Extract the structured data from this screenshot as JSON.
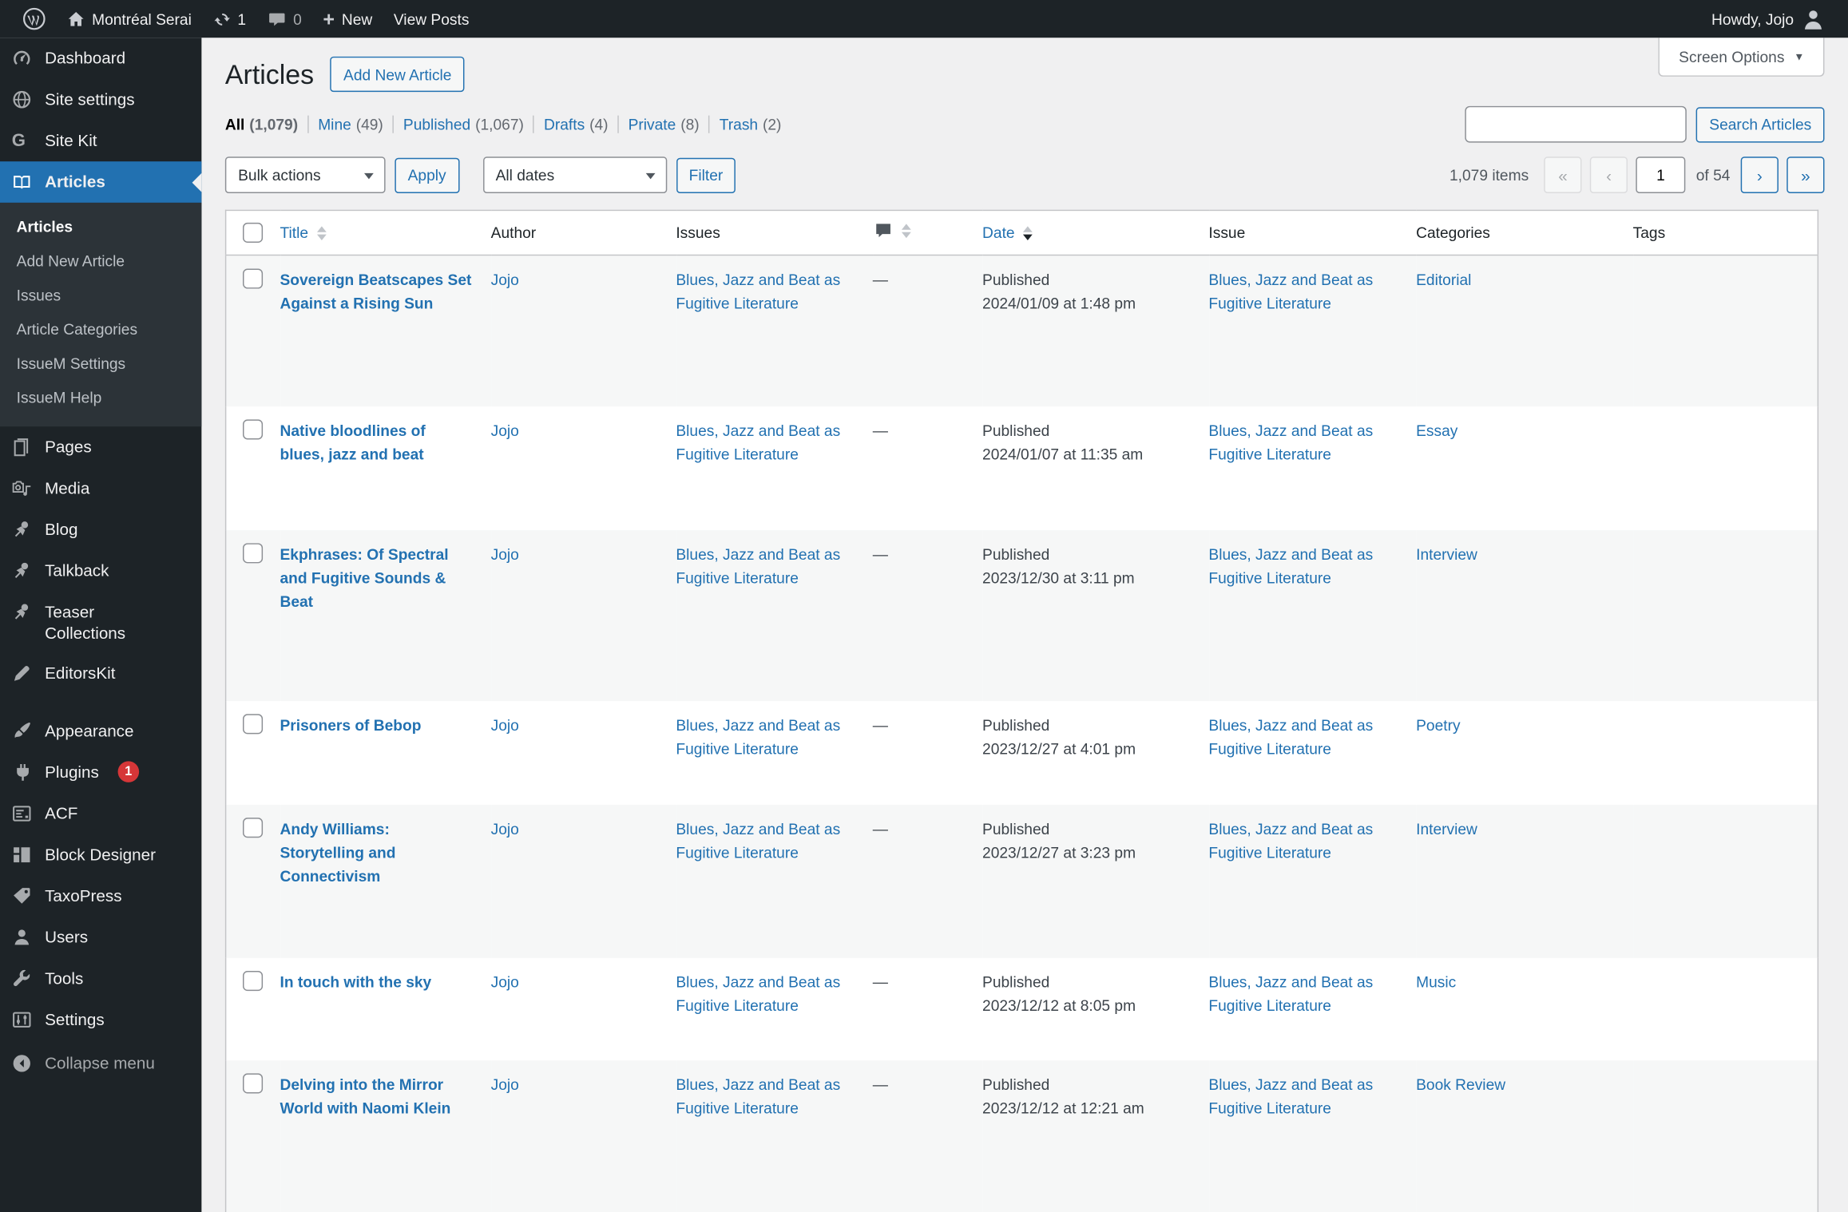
{
  "admin_bar": {
    "site_name": "Montréal Serai",
    "updates_count": "1",
    "comments_count": "0",
    "new_label": "New",
    "view_posts_label": "View Posts",
    "howdy": "Howdy, Jojo"
  },
  "sidebar": {
    "items": [
      {
        "label": "Dashboard"
      },
      {
        "label": "Site settings"
      },
      {
        "label": "Site Kit"
      },
      {
        "label": "Articles"
      },
      {
        "label": "Pages"
      },
      {
        "label": "Media"
      },
      {
        "label": "Blog"
      },
      {
        "label": "Talkback"
      },
      {
        "label": "Teaser Collections"
      },
      {
        "label": "EditorsKit"
      },
      {
        "label": "Appearance"
      },
      {
        "label": "Plugins"
      },
      {
        "label": "ACF"
      },
      {
        "label": "Block Designer"
      },
      {
        "label": "TaxoPress"
      },
      {
        "label": "Users"
      },
      {
        "label": "Tools"
      },
      {
        "label": "Settings"
      }
    ],
    "plugins_badge": "1",
    "articles_submenu": [
      {
        "label": "Articles"
      },
      {
        "label": "Add New Article"
      },
      {
        "label": "Issues"
      },
      {
        "label": "Article Categories"
      },
      {
        "label": "IssueM Settings"
      },
      {
        "label": "IssueM Help"
      }
    ],
    "collapse_label": "Collapse menu"
  },
  "page": {
    "title": "Articles",
    "add_new_label": "Add New Article",
    "screen_options_label": "Screen Options",
    "filters": [
      {
        "label": "All",
        "count": "(1,079)"
      },
      {
        "label": "Mine",
        "count": "(49)"
      },
      {
        "label": "Published",
        "count": "(1,067)"
      },
      {
        "label": "Drafts",
        "count": "(4)"
      },
      {
        "label": "Private",
        "count": "(8)"
      },
      {
        "label": "Trash",
        "count": "(2)"
      }
    ],
    "bulk_actions_value": "Bulk actions",
    "apply_label": "Apply",
    "dates_value": "All dates",
    "filter_label": "Filter",
    "search_button": "Search Articles",
    "pagination": {
      "items_text": "1,079 items",
      "first": "«",
      "prev": "‹",
      "current_page": "1",
      "of_text": "of 54",
      "next": "›",
      "last": "»"
    }
  },
  "table": {
    "headers": {
      "title": "Title",
      "author": "Author",
      "issues": "Issues",
      "date": "Date",
      "issue": "Issue",
      "categories": "Categories",
      "tags": "Tags"
    },
    "rows": [
      {
        "title": "Sovereign Beatscapes Set Against a Rising Sun",
        "author": "Jojo",
        "issues": "Blues, Jazz and Beat as Fugitive Literature",
        "comments": "—",
        "date_status": "Published",
        "date": "2024/01/09 at 1:48 pm",
        "issue": "Blues, Jazz and Beat as Fugitive Literature",
        "categories": "Editorial",
        "tags": ""
      },
      {
        "title": "Native bloodlines of blues, jazz and beat",
        "author": "Jojo",
        "issues": "Blues, Jazz and Beat as Fugitive Literature",
        "comments": "—",
        "date_status": "Published",
        "date": "2024/01/07 at 11:35 am",
        "issue": "Blues, Jazz and Beat as Fugitive Literature",
        "categories": "Essay",
        "tags": ""
      },
      {
        "title": "Ekphrases: Of Spectral and Fugitive Sounds & Beat",
        "author": "Jojo",
        "issues": "Blues, Jazz and Beat as Fugitive Literature",
        "comments": "—",
        "date_status": "Published",
        "date": "2023/12/30 at 3:11 pm",
        "issue": "Blues, Jazz and Beat as Fugitive Literature",
        "categories": "Interview",
        "tags": ""
      },
      {
        "title": "Prisoners of Bebop",
        "author": "Jojo",
        "issues": "Blues, Jazz and Beat as Fugitive Literature",
        "comments": "—",
        "date_status": "Published",
        "date": "2023/12/27 at 4:01 pm",
        "issue": "Blues, Jazz and Beat as Fugitive Literature",
        "categories": "Poetry",
        "tags": ""
      },
      {
        "title": "Andy Williams: Storytelling and Connectivism",
        "author": "Jojo",
        "issues": "Blues, Jazz and Beat as Fugitive Literature",
        "comments": "—",
        "date_status": "Published",
        "date": "2023/12/27 at 3:23 pm",
        "issue": "Blues, Jazz and Beat as Fugitive Literature",
        "categories": "Interview",
        "tags": ""
      },
      {
        "title": "In touch with the sky",
        "author": "Jojo",
        "issues": "Blues, Jazz and Beat as Fugitive Literature",
        "comments": "—",
        "date_status": "Published",
        "date": "2023/12/12 at 8:05 pm",
        "issue": "Blues, Jazz and Beat as Fugitive Literature",
        "categories": "Music",
        "tags": ""
      },
      {
        "title": "Delving into the Mirror World with Naomi Klein",
        "author": "Jojo",
        "issues": "Blues, Jazz and Beat as Fugitive Literature",
        "comments": "—",
        "date_status": "Published",
        "date": "2023/12/12 at 12:21 am",
        "issue": "Blues, Jazz and Beat as Fugitive Literature",
        "categories": "Book Review",
        "tags": ""
      }
    ]
  }
}
